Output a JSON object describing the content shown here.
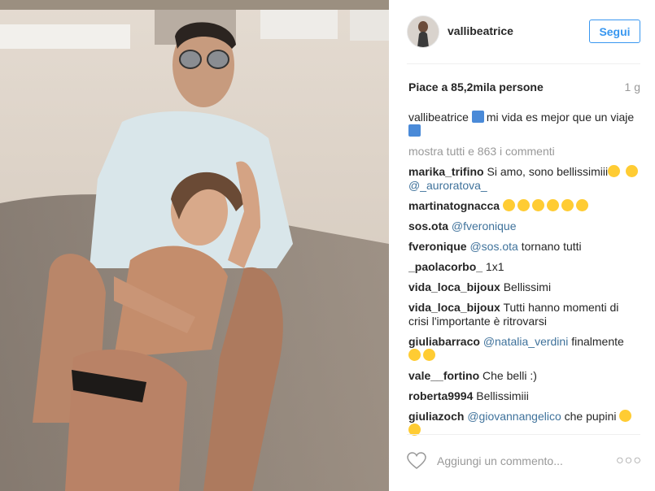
{
  "post": {
    "username": "vallibeatrice",
    "follow_label": "Segui",
    "likes_text": "Piace a 85,2mila persone",
    "age": "1 g",
    "caption_user": "vallibeatrice",
    "caption_text_1": "mi vida es mejor que un viaje",
    "show_all_comments": "mostra tutti e 863 i commenti",
    "add_comment_placeholder": "Aggiungi un commento...",
    "more_options": "○○○"
  },
  "comments": [
    {
      "user": "marika_trifino",
      "text": "Si amo, sono bellissimiii",
      "mention": "@_auroratova_"
    },
    {
      "user": "martinatognacca",
      "text": ""
    },
    {
      "user": "sos.ota",
      "mention": "@fveronique"
    },
    {
      "user": "fveronique",
      "mention": "@sos.ota",
      "text": "tornano tutti"
    },
    {
      "user": "_paolacorbo_",
      "text": "1x1"
    },
    {
      "user": "vida_loca_bijoux",
      "text": "Bellissimi"
    },
    {
      "user": "vida_loca_bijoux",
      "text": "Tutti hanno momenti di crisi l'importante è ritrovarsi"
    },
    {
      "user": "giuliabarraco",
      "mention": "@natalia_verdini",
      "text": "finalmente"
    },
    {
      "user": "vale__fortino",
      "text": "Che belli :)"
    },
    {
      "user": "roberta9994",
      "text": "Bellissimiii"
    },
    {
      "user": "giuliazoch",
      "mention": "@giovannangelico",
      "text": "che pupini"
    }
  ],
  "colors": {
    "accent": "#3897f0",
    "mention": "#3f729b",
    "muted": "#999999"
  }
}
